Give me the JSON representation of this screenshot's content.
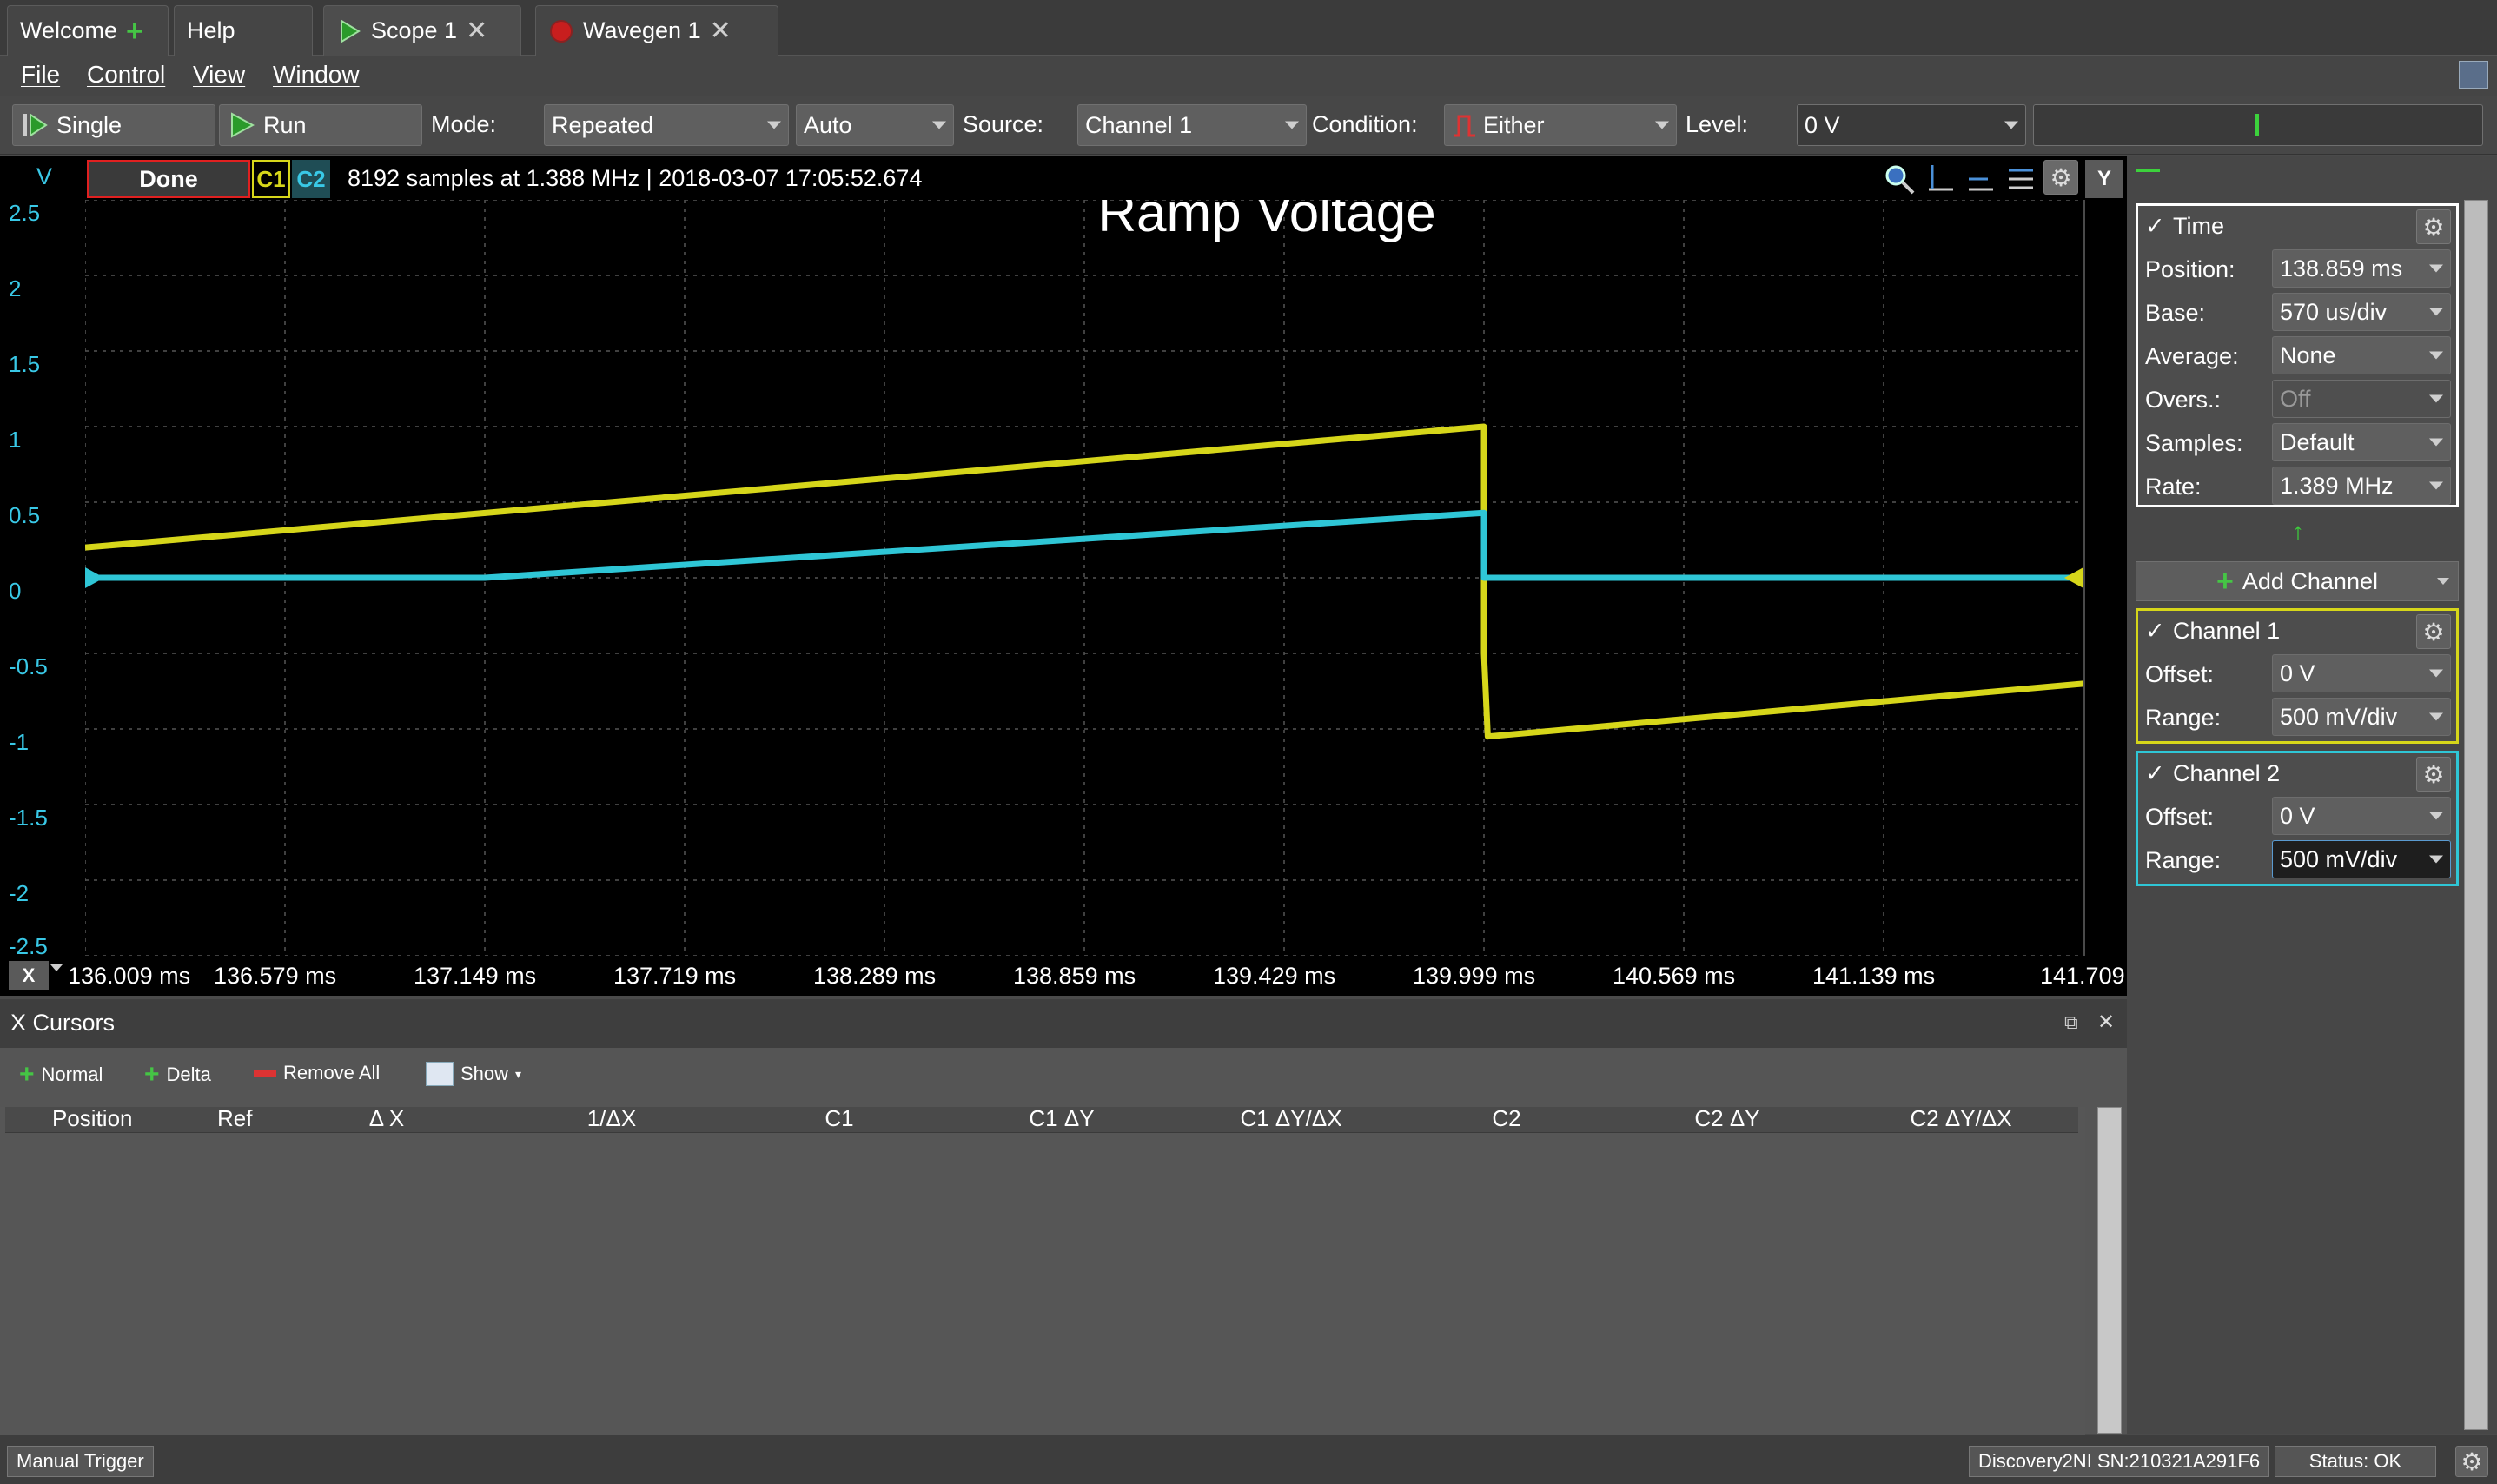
{
  "tabs": [
    {
      "label": "Welcome",
      "icon": "plus-icon"
    },
    {
      "label": "Help"
    },
    {
      "label": "Scope 1",
      "icon": "play-icon"
    },
    {
      "label": "Wavegen 1",
      "icon": "record-icon"
    }
  ],
  "menu": [
    "File",
    "Control",
    "View",
    "Window"
  ],
  "toolbar": {
    "single": "Single",
    "run": "Run",
    "mode_label": "Mode:",
    "mode": "Repeated",
    "auto": "Auto",
    "source_label": "Source:",
    "source": "Channel 1",
    "condition_label": "Condition:",
    "condition": "Either",
    "level_label": "Level:",
    "level": "0 V"
  },
  "scope": {
    "status": "Done",
    "c1": "C1",
    "c2": "C2",
    "info": "8192 samples at 1.388 MHz | 2018-03-07 17:05:52.674",
    "title": "Ramp Voltage",
    "v_label": "V",
    "y_button": "Y",
    "x_button": "X"
  },
  "chart_data": {
    "type": "line",
    "title": "Ramp Voltage",
    "ylabel": "V",
    "ylim": [
      -2.5,
      2.5
    ],
    "xlim": [
      136.009,
      141.709
    ],
    "grid": true,
    "y_ticks": [
      "2.5",
      "2",
      "1.5",
      "1",
      "0.5",
      "0",
      "-0.5",
      "-1",
      "-1.5",
      "-2",
      "-2.5"
    ],
    "x_ticks": [
      "136.009 ms",
      "136.579 ms",
      "137.149 ms",
      "137.719 ms",
      "138.289 ms",
      "138.859 ms",
      "139.429 ms",
      "139.999 ms",
      "140.569 ms",
      "141.139 ms",
      "141.709"
    ],
    "series": [
      {
        "name": "C1",
        "color": "#d6d61a",
        "x": [
          136.009,
          139.999,
          139.999,
          140.01,
          141.709
        ],
        "y": [
          0.2,
          1.0,
          -0.5,
          -1.05,
          -0.7
        ]
      },
      {
        "name": "C2",
        "color": "#2fc6d6",
        "x": [
          136.009,
          137.149,
          139.999,
          139.999,
          141.709
        ],
        "y": [
          0.0,
          0.0,
          0.43,
          0.0,
          0.0
        ]
      }
    ]
  },
  "time": {
    "header": "Time",
    "rows": [
      {
        "label": "Position:",
        "value": "138.859 ms"
      },
      {
        "label": "Base:",
        "value": "570 us/div"
      },
      {
        "label": "Average:",
        "value": "None"
      },
      {
        "label": "Overs.:",
        "value": "Off"
      },
      {
        "label": "Samples:",
        "value": "Default"
      },
      {
        "label": "Rate:",
        "value": "1.389 MHz"
      }
    ]
  },
  "add_channel": "Add Channel",
  "channel1": {
    "header": "Channel 1",
    "offset_label": "Offset:",
    "offset": "0 V",
    "range_label": "Range:",
    "range": "500 mV/div"
  },
  "channel2": {
    "header": "Channel 2",
    "offset_label": "Offset:",
    "offset": "0 V",
    "range_label": "Range:",
    "range": "500 mV/div"
  },
  "cursors": {
    "title": "X Cursors",
    "buttons": {
      "normal": "Normal",
      "delta": "Delta",
      "remove_all": "Remove All",
      "show": "Show"
    },
    "columns": [
      "Position",
      "Ref",
      "Δ X",
      "1/ΔX",
      "C1",
      "C1 ΔY",
      "C1 ΔY/ΔX",
      "C2",
      "C2 ΔY",
      "C2 ΔY/ΔX"
    ]
  },
  "status": {
    "manual_trigger": "Manual Trigger",
    "device": "Discovery2NI SN:210321A291F6",
    "status": "Status: OK"
  },
  "colors": {
    "c1": "#d6d61a",
    "c2": "#2fc6d6",
    "done": "#e02020",
    "accent_green": "#45c545"
  }
}
